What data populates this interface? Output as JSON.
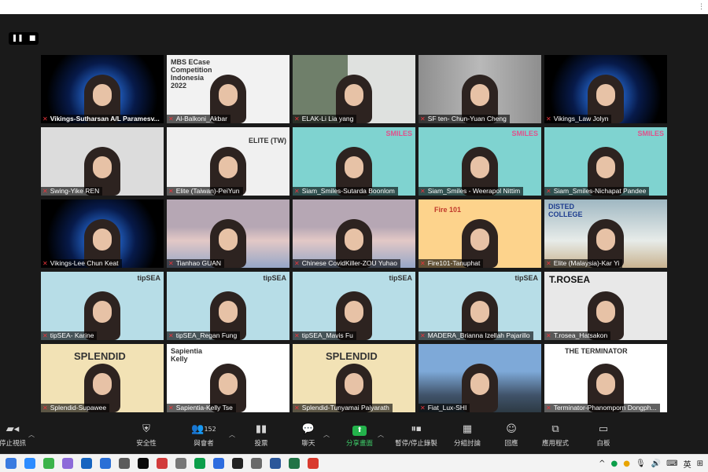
{
  "view_controls": {
    "pause_glyph": "❚❚",
    "stop_glyph": "■"
  },
  "participants": [
    {
      "name": "Vikings-Sutharsan A/L Paramesv...",
      "bg": "vikings",
      "bold": true
    },
    {
      "name": "Al-Balkoni_Akbar",
      "bg": "mbs",
      "overlay": [
        "MBS ECase",
        "Competition",
        "Indonesia",
        "2022"
      ]
    },
    {
      "name": "ELAK-Li Lia yang",
      "bg": "elak"
    },
    {
      "name": "SF ten- Chun-Yuan Cheng",
      "bg": "sf"
    },
    {
      "name": "Vikings_Law Jolyn",
      "bg": "vikings"
    },
    {
      "name": "Swing-Yike REN",
      "bg": "swing"
    },
    {
      "name": "Elite (Taiwan)-PeiYun",
      "bg": "elite",
      "overlay": [
        "ELITE (TW)"
      ]
    },
    {
      "name": "Siam_Smiles-Sutarda Boonlom",
      "bg": "siam",
      "overlay": [
        "SMILES"
      ]
    },
    {
      "name": "Siam_Smiles - Weerapol Nittim",
      "bg": "siam",
      "overlay": [
        "SMILES"
      ]
    },
    {
      "name": "Siam_Smiles-Nichapat Pandee",
      "bg": "siam",
      "overlay": [
        "SMILES"
      ]
    },
    {
      "name": "Vikings-Lee Chun Keat",
      "bg": "vikings"
    },
    {
      "name": "Tianhao GUAN",
      "bg": "tian"
    },
    {
      "name": "Chinese CovidKiller-ZOU Yuhao",
      "bg": "tian"
    },
    {
      "name": "Fire101-Tanuphat",
      "bg": "fire",
      "overlay": [
        "Fire 101"
      ]
    },
    {
      "name": "Elite (Malaysia)-Kar Yi",
      "bg": "elitem",
      "overlay": [
        "DISTED",
        "COLLEGE"
      ]
    },
    {
      "name": "tipSEA- Karine",
      "bg": "tipsea",
      "overlay": [
        "tipSEA"
      ]
    },
    {
      "name": "tipSEA_Regan Fung",
      "bg": "tipsea",
      "overlay": [
        "tipSEA"
      ]
    },
    {
      "name": "tipSEA_Mavis Fu",
      "bg": "tipsea",
      "overlay": [
        "tipSEA"
      ]
    },
    {
      "name": "MADERA_Brianna Izellah Pajarillo",
      "bg": "madera",
      "overlay": [
        "tipSEA"
      ]
    },
    {
      "name": "T.rosea_Hatsakon",
      "bg": "trosea",
      "overlay": [
        "T.ROSEA"
      ]
    },
    {
      "name": "Splendid-Supawee",
      "bg": "splendid",
      "overlay": [
        "SPLENDID"
      ]
    },
    {
      "name": "Sapientia-Kelly Tse",
      "bg": "sapientia",
      "overlay": [
        "Sapientia",
        "Kelly"
      ]
    },
    {
      "name": "Splendid-Tunyamai Paiyarath",
      "bg": "splendid",
      "overlay": [
        "SPLENDID"
      ]
    },
    {
      "name": "Fiat_Lux-SHI",
      "bg": "fiat"
    },
    {
      "name": "Terminator-Phanomporn Dongph...",
      "bg": "term",
      "overlay": [
        "THE TERMINATOR"
      ]
    }
  ],
  "toolbar": {
    "stop_video": "停止視訊",
    "security": "安全性",
    "participants": "與會者",
    "participants_count": "152",
    "polls": "投票",
    "chat": "聊天",
    "share_screen": "分享畫面",
    "record": "暫停/停止錄製",
    "breakout": "分組討論",
    "reactions": "回應",
    "apps": "應用程式",
    "whiteboard": "白板"
  },
  "taskbar": {
    "ime": "英",
    "tray_caret": "^"
  },
  "colors": {
    "share_green": "#23b24b",
    "muted_red": "#e8343a",
    "window_bg": "#1a1a1a"
  }
}
